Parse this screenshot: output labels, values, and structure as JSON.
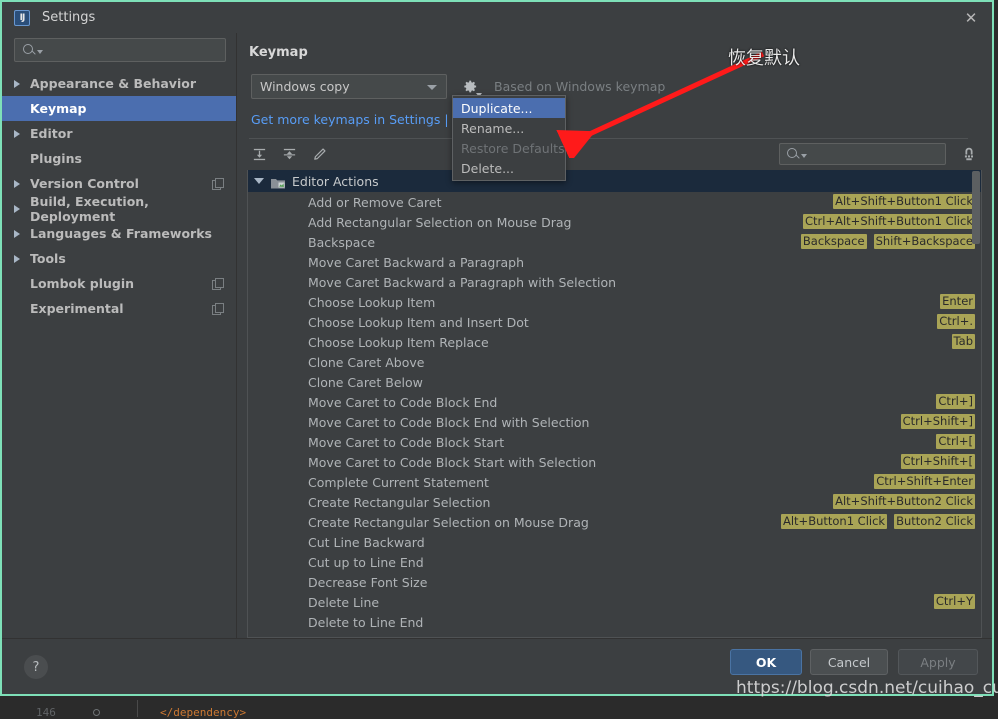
{
  "window": {
    "title": "Settings",
    "app_icon": "intellij-idea-icon",
    "close_label": "✕"
  },
  "sidebar": {
    "search_placeholder": "",
    "search_icon": "search-icon",
    "items": [
      {
        "label": "Appearance & Behavior",
        "expandable": true,
        "selected": false,
        "badge": false
      },
      {
        "label": "Keymap",
        "expandable": false,
        "selected": true,
        "badge": false
      },
      {
        "label": "Editor",
        "expandable": true,
        "selected": false,
        "badge": false
      },
      {
        "label": "Plugins",
        "expandable": false,
        "selected": false,
        "badge": false
      },
      {
        "label": "Version Control",
        "expandable": true,
        "selected": false,
        "badge": true
      },
      {
        "label": "Build, Execution, Deployment",
        "expandable": true,
        "selected": false,
        "badge": false
      },
      {
        "label": "Languages & Frameworks",
        "expandable": true,
        "selected": false,
        "badge": false
      },
      {
        "label": "Tools",
        "expandable": true,
        "selected": false,
        "badge": false
      },
      {
        "label": "Lombok plugin",
        "expandable": false,
        "selected": false,
        "badge": true
      },
      {
        "label": "Experimental",
        "expandable": false,
        "selected": false,
        "badge": true
      }
    ]
  },
  "content": {
    "page_title": "Keymap",
    "keymap_selected": "Windows copy",
    "gear_icon": "gear-icon",
    "based_on_label": "Based on Windows keymap",
    "keymaps_link": "Get more keymaps in Settings | Plugins",
    "toolbar": {
      "expand_all_icon": "expand-all-icon",
      "collapse_all_icon": "collapse-all-icon",
      "edit_icon": "pencil-edit-icon",
      "search_placeholder": "",
      "search_icon": "search-icon",
      "find_by_shortcut_icon": "find-by-shortcut-icon"
    },
    "group": {
      "label": "Editor Actions",
      "expanded": true,
      "folder_icon": "folder-actions-icon"
    },
    "actions": [
      {
        "name": "Add or Remove Caret",
        "shortcuts": [
          "Alt+Shift+Button1 Click"
        ]
      },
      {
        "name": "Add Rectangular Selection on Mouse Drag",
        "shortcuts": [
          "Ctrl+Alt+Shift+Button1 Click"
        ]
      },
      {
        "name": "Backspace",
        "shortcuts": [
          "Backspace",
          "Shift+Backspace"
        ]
      },
      {
        "name": "Move Caret Backward a Paragraph",
        "shortcuts": []
      },
      {
        "name": "Move Caret Backward a Paragraph with Selection",
        "shortcuts": []
      },
      {
        "name": "Choose Lookup Item",
        "shortcuts": [
          "Enter"
        ]
      },
      {
        "name": "Choose Lookup Item and Insert Dot",
        "shortcuts": [
          "Ctrl+."
        ]
      },
      {
        "name": "Choose Lookup Item Replace",
        "shortcuts": [
          "Tab"
        ]
      },
      {
        "name": "Clone Caret Above",
        "shortcuts": []
      },
      {
        "name": "Clone Caret Below",
        "shortcuts": []
      },
      {
        "name": "Move Caret to Code Block End",
        "shortcuts": [
          "Ctrl+]"
        ]
      },
      {
        "name": "Move Caret to Code Block End with Selection",
        "shortcuts": [
          "Ctrl+Shift+]"
        ]
      },
      {
        "name": "Move Caret to Code Block Start",
        "shortcuts": [
          "Ctrl+["
        ]
      },
      {
        "name": "Move Caret to Code Block Start with Selection",
        "shortcuts": [
          "Ctrl+Shift+["
        ]
      },
      {
        "name": "Complete Current Statement",
        "shortcuts": [
          "Ctrl+Shift+Enter"
        ]
      },
      {
        "name": "Create Rectangular Selection",
        "shortcuts": [
          "Alt+Shift+Button2 Click"
        ]
      },
      {
        "name": "Create Rectangular Selection on Mouse Drag",
        "shortcuts": [
          "Alt+Button1 Click",
          "Button2 Click"
        ]
      },
      {
        "name": "Cut Line Backward",
        "shortcuts": []
      },
      {
        "name": "Cut up to Line End",
        "shortcuts": []
      },
      {
        "name": "Decrease Font Size",
        "shortcuts": []
      },
      {
        "name": "Delete Line",
        "shortcuts": [
          "Ctrl+Y"
        ]
      },
      {
        "name": "Delete to Line End",
        "shortcuts": []
      }
    ]
  },
  "gear_menu": {
    "items": [
      {
        "label": "Duplicate...",
        "state": "active"
      },
      {
        "label": "Rename...",
        "state": "normal"
      },
      {
        "label": "Restore Defaults",
        "state": "disabled"
      },
      {
        "label": "Delete...",
        "state": "normal"
      }
    ]
  },
  "footer": {
    "help_label": "?",
    "ok_label": "OK",
    "cancel_label": "Cancel",
    "apply_label": "Apply"
  },
  "annotation": {
    "text": "恢复默认",
    "arrow_color": "#ff1a1a"
  },
  "watermark": {
    "text": "https://blog.csdn.net/cuihao_cuihao"
  },
  "ide_background": {
    "line_number": "146",
    "code_text": "</dependency>"
  },
  "colors": {
    "window_bg": "#3c3f41",
    "selection_blue": "#4b6eaf",
    "group_row_bg": "#1b2a3c",
    "shortcut_badge": "#a9a456",
    "link_blue": "#589df6",
    "border_accent": "#7ee0b8",
    "ok_button": "#365880"
  }
}
